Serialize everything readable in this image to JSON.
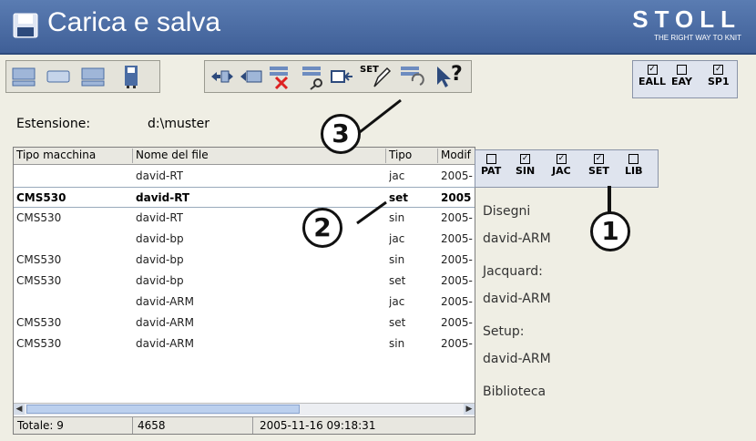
{
  "header": {
    "title": "Carica e salva",
    "brand": "STOLL",
    "tagline": "THE RIGHT WAY TO KNIT",
    "accent": "#4a6ca3"
  },
  "toolbar": {
    "left_icons": [
      "computer-icon",
      "drive-icon",
      "network-computer-icon",
      "save-disk-icon"
    ],
    "middle_icons": [
      "transfer-arrows-icon",
      "copy-icon",
      "delete-icon",
      "find-icon",
      "import-icon",
      "set-edit-icon",
      "convert-icon",
      "help-cursor-icon"
    ],
    "set_label": "SET",
    "help_label": "?"
  },
  "export_flags": [
    {
      "label": "EALL",
      "checked": true
    },
    {
      "label": "EAY",
      "checked": false
    },
    {
      "label": "SP1",
      "checked": true
    }
  ],
  "extension": {
    "label": "Estensione:",
    "value": "d:\\muster"
  },
  "table": {
    "columns": [
      "Tipo macchina",
      "Nome del file",
      "Tipo",
      "Modif"
    ],
    "rows": [
      {
        "machine": "",
        "name": "david-RT",
        "type": "jac",
        "date": "2005-"
      },
      {
        "machine": "CMS530",
        "name": "david-RT",
        "type": "set",
        "date": "2005"
      },
      {
        "machine": "CMS530",
        "name": "david-RT",
        "type": "sin",
        "date": "2005-"
      },
      {
        "machine": "",
        "name": "david-bp",
        "type": "jac",
        "date": "2005-"
      },
      {
        "machine": "CMS530",
        "name": "david-bp",
        "type": "sin",
        "date": "2005-"
      },
      {
        "machine": "CMS530",
        "name": "david-bp",
        "type": "set",
        "date": "2005-"
      },
      {
        "machine": "",
        "name": "david-ARM",
        "type": "jac",
        "date": "2005-"
      },
      {
        "machine": "CMS530",
        "name": "david-ARM",
        "type": "set",
        "date": "2005-"
      },
      {
        "machine": "CMS530",
        "name": "david-ARM",
        "type": "sin",
        "date": "2005-"
      }
    ],
    "selected_index": 1
  },
  "status": {
    "total": "Totale:  9",
    "size": "4658",
    "timestamp": "2005-11-16 09:18:31"
  },
  "filters": [
    {
      "label": "PAT",
      "checked": false
    },
    {
      "label": "SIN",
      "checked": true
    },
    {
      "label": "JAC",
      "checked": true
    },
    {
      "label": "SET",
      "checked": true
    },
    {
      "label": "LIB",
      "checked": false
    }
  ],
  "side_panel": {
    "disegni_label": "Disegni",
    "disegni_value": "david-ARM",
    "jacquard_label": "Jacquard:",
    "jacquard_value": "david-ARM",
    "setup_label": "Setup:",
    "setup_value": "david-ARM",
    "biblioteca_label": "Biblioteca"
  },
  "callouts": [
    "1",
    "2",
    "3"
  ]
}
